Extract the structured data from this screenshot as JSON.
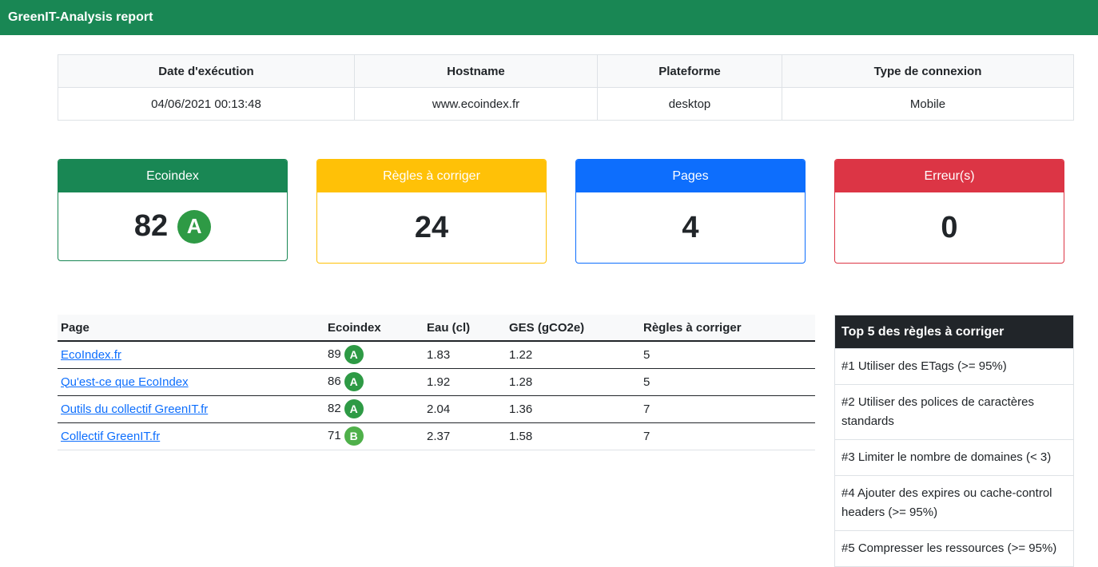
{
  "navbar": {
    "title": "GreenIT-Analysis report"
  },
  "info": {
    "headers": [
      "Date d'exécution",
      "Hostname",
      "Plateforme",
      "Type de connexion"
    ],
    "values": [
      "04/06/2021 00:13:48",
      "www.ecoindex.fr",
      "desktop",
      "Mobile"
    ]
  },
  "cards": {
    "ecoindex": {
      "label": "Ecoindex",
      "value": "82",
      "grade": "A",
      "grade_color": "#2e9a45"
    },
    "rules": {
      "label": "Règles à corriger",
      "value": "24"
    },
    "pages": {
      "label": "Pages",
      "value": "4"
    },
    "errors": {
      "label": "Erreur(s)",
      "value": "0"
    }
  },
  "colors": {
    "navbar": "#198754",
    "ecoindex": "#198754",
    "rules": "#ffc107",
    "pages": "#0d6efd",
    "errors": "#dc3545",
    "grade_a": "#2e9a45",
    "grade_b": "#4fb04a"
  },
  "pages_table": {
    "headers": [
      "Page",
      "Ecoindex",
      "Eau (cl)",
      "GES (gCO2e)",
      "Règles à corriger"
    ],
    "rows": [
      {
        "page": "EcoIndex.fr",
        "ecoindex": "89",
        "grade": "A",
        "eau": "1.83",
        "ges": "1.22",
        "regles": "5"
      },
      {
        "page": "Qu'est-ce que EcoIndex",
        "ecoindex": "86",
        "grade": "A",
        "eau": "1.92",
        "ges": "1.28",
        "regles": "5"
      },
      {
        "page": "Outils du collectif GreenIT.fr",
        "ecoindex": "82",
        "grade": "A",
        "eau": "2.04",
        "ges": "1.36",
        "regles": "7"
      },
      {
        "page": "Collectif GreenIT.fr",
        "ecoindex": "71",
        "grade": "B",
        "eau": "2.37",
        "ges": "1.58",
        "regles": "7"
      }
    ]
  },
  "top5": {
    "title": "Top 5 des règles à corriger",
    "items": [
      "#1 Utiliser des ETags (>= 95%)",
      "#2 Utiliser des polices de caractères standards",
      "#3 Limiter le nombre de domaines (< 3)",
      "#4 Ajouter des expires ou cache-control headers (>= 95%)",
      "#5 Compresser les ressources (>= 95%)"
    ]
  }
}
